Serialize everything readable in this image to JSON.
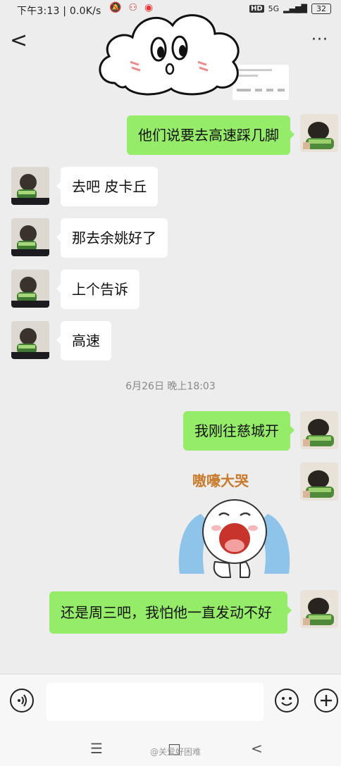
{
  "status_bar": {
    "time_speed": "下午3:13 | 0.0K/s",
    "hd_badge": "HD",
    "network": "5G",
    "battery": "32"
  },
  "nav": {
    "back_glyph": "<",
    "more_glyph": "···"
  },
  "messages": [
    {
      "side": "out",
      "text": "他们说要去高速踩几脚"
    },
    {
      "side": "in",
      "text": "去吧 皮卡丘"
    },
    {
      "side": "in",
      "text": "那去余姚好了"
    },
    {
      "side": "in",
      "text": "上个告诉"
    },
    {
      "side": "in",
      "text": "高速"
    },
    {
      "side": "out",
      "text": "我刚往慈城开"
    },
    {
      "side": "out",
      "type": "sticker",
      "caption": "嗷嚎大哭"
    },
    {
      "side": "out",
      "text": "还是周三吧，我怕他一直发动不好"
    }
  ],
  "timestamp": "6月26日 晚上18:03",
  "input_bar": {
    "voice_icon": "voice-icon",
    "emoji_icon": "emoji-icon",
    "plus_icon": "plus-icon"
  },
  "system_nav": {
    "menu_glyph": "☰",
    "home_glyph": "□",
    "back_glyph": "<"
  },
  "watermark": "@关爱好困难"
}
